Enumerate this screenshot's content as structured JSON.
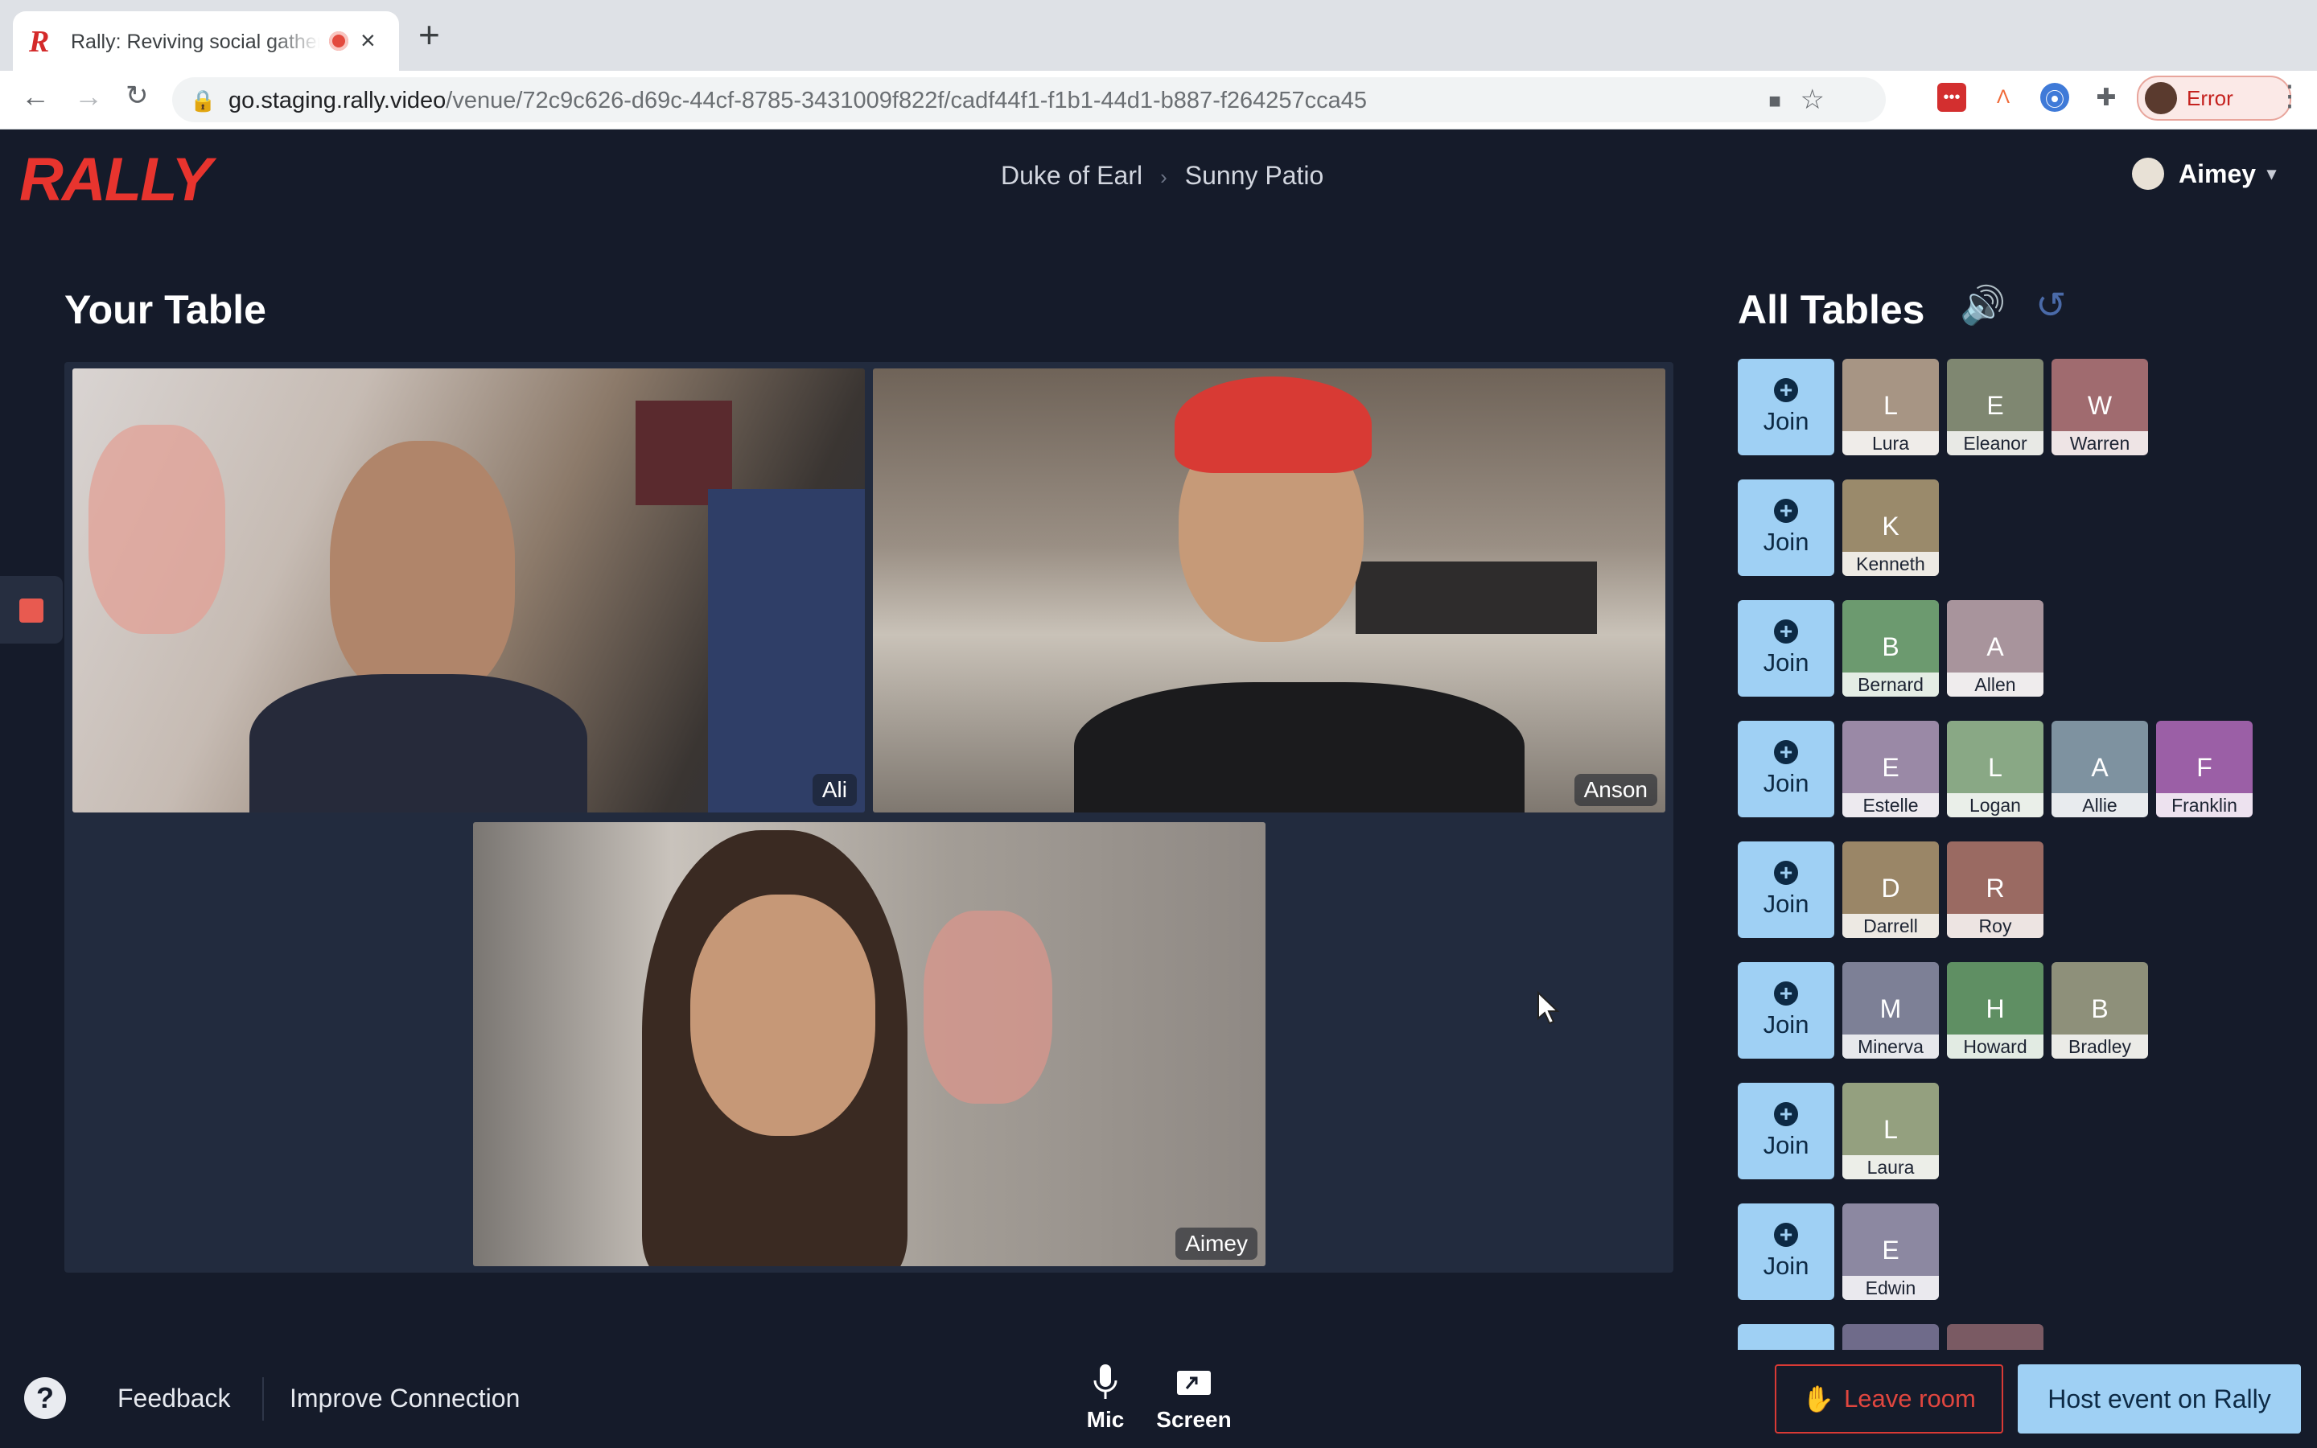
{
  "browser": {
    "tab_title": "Rally: Reviving social gatherings",
    "favicon_letter": "R",
    "close_glyph": "×",
    "newtab_glyph": "+",
    "url_host": "go.staging.rally.video",
    "url_path": "/venue/72c9c626-d69c-44cf-8785-3431009f822f/cadf44f1-f1b1-44d1-b887-f264257cca45",
    "profile_status": "Error",
    "icons": [
      "back-icon",
      "forward-icon",
      "reload-icon",
      "lock-icon",
      "camera-icon",
      "star-icon",
      "extension-red-icon",
      "extension-triangle-icon",
      "extension-blue-icon",
      "puzzle-icon",
      "kebab-menu-icon"
    ]
  },
  "app": {
    "logo": "RALLY",
    "breadcrumb": [
      "Duke of Earl",
      "Sunny Patio"
    ],
    "breadcrumb_sep": "›",
    "user_name": "Aimey",
    "user_chevron": "⌄"
  },
  "your_table": {
    "title": "Your Table",
    "participants": [
      {
        "name": "Ali"
      },
      {
        "name": "Anson"
      },
      {
        "name": "Aimey"
      }
    ]
  },
  "all_tables": {
    "title": "All Tables",
    "join_label": "Join",
    "join_plus": "+",
    "speaker_icon": "🔊",
    "history_icon": "↺",
    "rows": [
      [
        {
          "i": "L",
          "n": "Lura",
          "c": "#a79584"
        },
        {
          "i": "E",
          "n": "Eleanor",
          "c": "#7f8771"
        },
        {
          "i": "W",
          "n": "Warren",
          "c": "#a06b6f"
        }
      ],
      [
        {
          "i": "K",
          "n": "Kenneth",
          "c": "#9a8a6b"
        }
      ],
      [
        {
          "i": "B",
          "n": "Bernard",
          "c": "#6c9a6f"
        },
        {
          "i": "A",
          "n": "Allen",
          "c": "#a8949c"
        }
      ],
      [
        {
          "i": "E",
          "n": "Estelle",
          "c": "#9a89a6"
        },
        {
          "i": "L",
          "n": "Logan",
          "c": "#89a885"
        },
        {
          "i": "A",
          "n": "Allie",
          "c": "#7e92a0"
        },
        {
          "i": "F",
          "n": "Franklin",
          "c": "#9b5fa6"
        }
      ],
      [
        {
          "i": "D",
          "n": "Darrell",
          "c": "#9a8667"
        },
        {
          "i": "R",
          "n": "Roy",
          "c": "#9a6a62"
        }
      ],
      [
        {
          "i": "M",
          "n": "Minerva",
          "c": "#7d8096"
        },
        {
          "i": "H",
          "n": "Howard",
          "c": "#5f8f63"
        },
        {
          "i": "B",
          "n": "Bradley",
          "c": "#8e907a"
        }
      ],
      [
        {
          "i": "L",
          "n": "Laura",
          "c": "#94a07f"
        }
      ],
      [
        {
          "i": "E",
          "n": "Edwin",
          "c": "#8c88a1"
        }
      ]
    ]
  },
  "footer": {
    "help": "?",
    "feedback": "Feedback",
    "improve_connection": "Improve Connection",
    "mic": "Mic",
    "screen": "Screen",
    "leave_room": "Leave room",
    "host_event": "Host event on Rally"
  }
}
